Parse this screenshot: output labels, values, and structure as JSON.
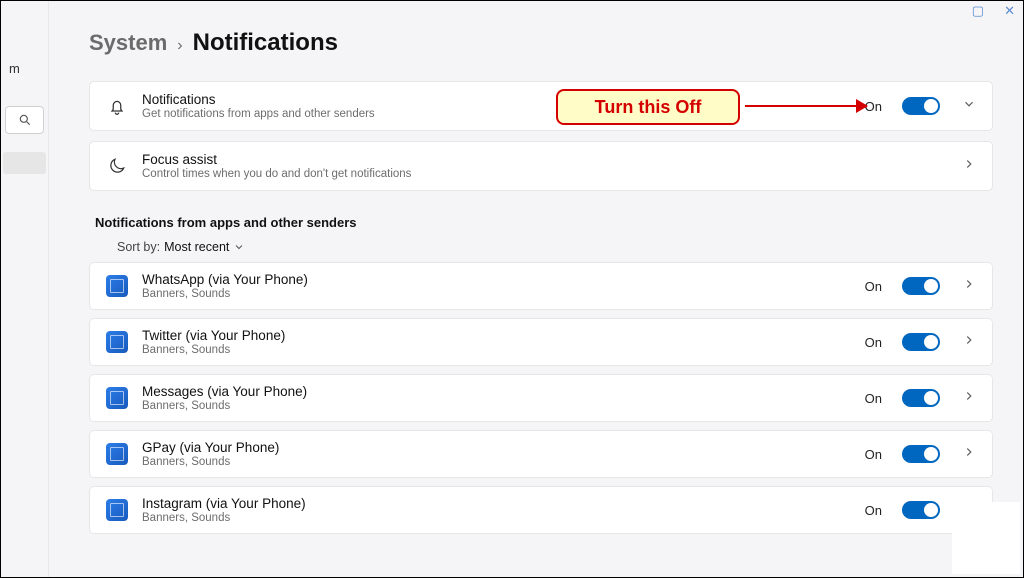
{
  "breadcrumb": {
    "parent": "System",
    "current": "Notifications"
  },
  "left": {
    "letter": "m"
  },
  "master": {
    "title": "Notifications",
    "subtitle": "Get notifications from apps and other senders",
    "state_label": "On"
  },
  "focus": {
    "title": "Focus assist",
    "subtitle": "Control times when you do and don't get notifications"
  },
  "section_heading": "Notifications from apps and other senders",
  "sort": {
    "prefix": "Sort by:",
    "value": "Most recent"
  },
  "apps": [
    {
      "title": "WhatsApp (via Your Phone)",
      "subtitle": "Banners, Sounds",
      "state_label": "On"
    },
    {
      "title": "Twitter (via Your Phone)",
      "subtitle": "Banners, Sounds",
      "state_label": "On"
    },
    {
      "title": "Messages (via Your Phone)",
      "subtitle": "Banners, Sounds",
      "state_label": "On"
    },
    {
      "title": "GPay (via Your Phone)",
      "subtitle": "Banners, Sounds",
      "state_label": "On"
    },
    {
      "title": "Instagram (via Your Phone)",
      "subtitle": "Banners, Sounds",
      "state_label": "On"
    }
  ],
  "annotation": {
    "text": "Turn this Off"
  }
}
